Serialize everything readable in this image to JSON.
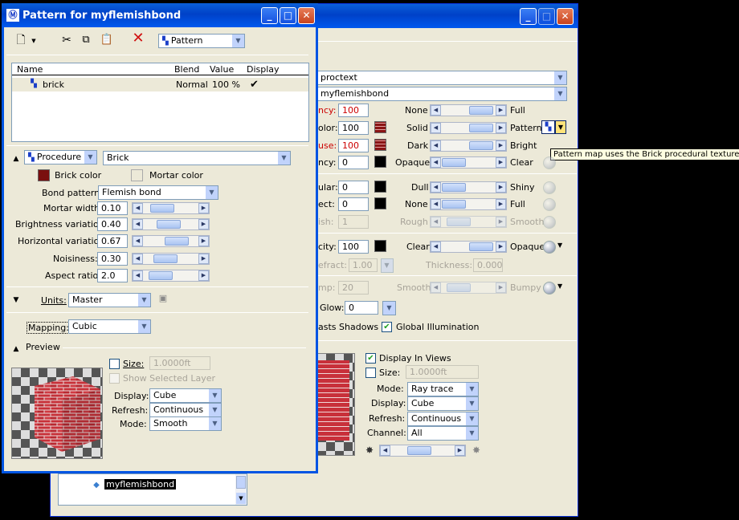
{
  "back_window": {
    "type_dropdown": "proctext",
    "material_dropdown": "myflemishbond",
    "rows": [
      {
        "label": "ncy:",
        "value": "100",
        "left": "None",
        "right": "Full"
      },
      {
        "label": "olor:",
        "value": "100",
        "left": "Solid",
        "right": "Pattern"
      },
      {
        "label": "use:",
        "value": "100",
        "left": "Dark",
        "right": "Bright"
      },
      {
        "label": "ncy:",
        "value": "0",
        "left": "Opaque",
        "right": "Clear"
      },
      {
        "label": "ular:",
        "value": "0",
        "left": "Dull",
        "right": "Shiny"
      },
      {
        "label": "ect:",
        "value": "0",
        "left": "None",
        "right": "Full"
      },
      {
        "label": "ish:",
        "value": "1",
        "left": "Rough",
        "right": "Smooth"
      },
      {
        "label": "city:",
        "value": "100",
        "left": "Clear",
        "right": "Opaque"
      }
    ],
    "refract_label": "efract:",
    "refract_value": "1.00",
    "thickness_label": "Thickness:",
    "thickness_value": "0.000",
    "bump_label": "mp:",
    "bump_value": "20",
    "bump_left": "Smooth",
    "bump_right": "Bumpy",
    "glow_label": "Glow:",
    "glow_value": "0",
    "casts_shadows": "asts Shadows",
    "global_illumination": "Global Illumination",
    "display_in_views": "Display In Views",
    "size_label": "Size:",
    "size_value": "1.0000ft",
    "mode_label": "Mode:",
    "mode_value": "Ray trace",
    "display_label": "Display:",
    "display_value": "Cube",
    "refresh_label": "Refresh:",
    "refresh_value": "Continuous",
    "channel_label": "Channel:",
    "channel_value": "All",
    "tree_item": "myflemishbond",
    "tooltip": "Pattern map uses the Brick procedural texture"
  },
  "front_window": {
    "title": "Pattern for myflemishbond",
    "toolbar_dropdown": "Pattern",
    "list_headers": [
      "Name",
      "Blend",
      "Value",
      "Display"
    ],
    "list_row": {
      "name": "brick",
      "blend": "Normal",
      "value": "100 %",
      "display": "✔"
    },
    "procedure_label": "Procedure",
    "procedure_value": "Brick",
    "brick_color": "Brick color",
    "mortar_color": "Mortar color",
    "bond_pattern_label": "Bond pattern:",
    "bond_pattern_value": "Flemish bond",
    "params": [
      {
        "label": "Mortar width:",
        "value": "0.10"
      },
      {
        "label": "Brightness variation:",
        "value": "0.40"
      },
      {
        "label": "Horizontal variation:",
        "value": "0.67"
      },
      {
        "label": "Noisiness:",
        "value": "0.30"
      },
      {
        "label": "Aspect ratio:",
        "value": "2.0"
      }
    ],
    "units_label": "Units:",
    "units_value": "Master",
    "mapping_label": "Mapping:",
    "mapping_value": "Cubic",
    "preview_label": "Preview",
    "size_label": "Size:",
    "size_value": "1.0000ft",
    "show_selected_layer": "Show Selected Layer",
    "display_label": "Display:",
    "display_value": "Cube",
    "refresh_label": "Refresh:",
    "refresh_value": "Continuous",
    "mode_label": "Mode:",
    "mode_value": "Smooth"
  },
  "colors": {
    "brick": "#7a0f0f",
    "mortar": "#ece9d8",
    "titlebar": "#0054e3",
    "required": "#cc0000"
  }
}
